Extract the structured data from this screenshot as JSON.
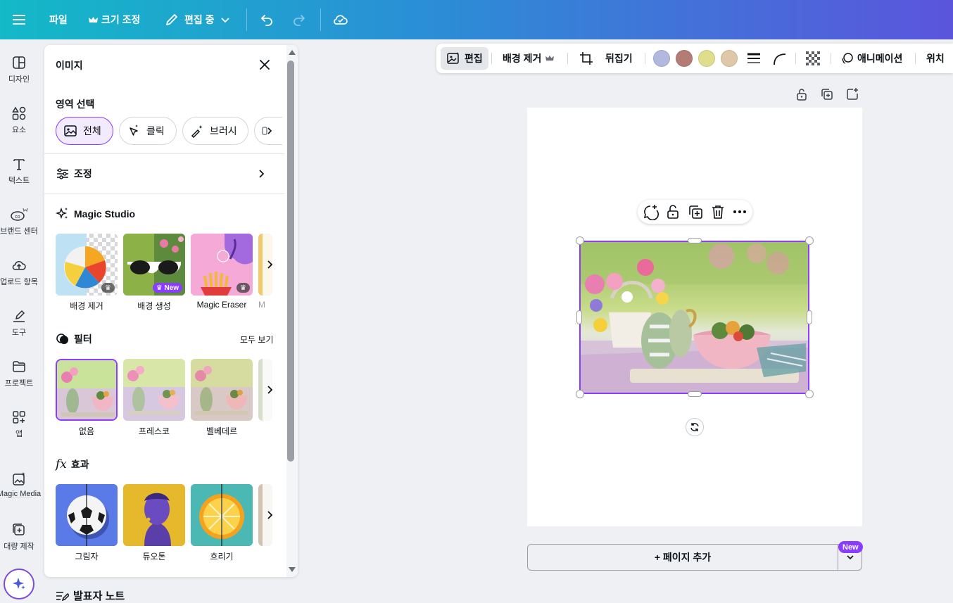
{
  "topbar": {
    "file": "파일",
    "resize": "크기 조정",
    "edit_mode": "편집 중"
  },
  "rail": {
    "items": [
      {
        "label": "디자인"
      },
      {
        "label": "요소"
      },
      {
        "label": "텍스트"
      },
      {
        "label": "브랜드 센터"
      },
      {
        "label": "업로드 항목"
      },
      {
        "label": "도구"
      },
      {
        "label": "프로젝트"
      },
      {
        "label": "앱"
      },
      {
        "label": "Magic Media"
      },
      {
        "label": "대량 제작"
      }
    ]
  },
  "panel": {
    "title": "이미지",
    "select_area": {
      "title": "영역 선택",
      "chips": [
        {
          "label": "전체"
        },
        {
          "label": "클릭"
        },
        {
          "label": "브러시"
        }
      ]
    },
    "adjust": "조정",
    "magic_studio": {
      "title": "Magic Studio",
      "items": [
        {
          "label": "배경 제거"
        },
        {
          "label": "배경 생성",
          "badge": "New"
        },
        {
          "label": "Magic Eraser"
        },
        {
          "label": "M"
        }
      ]
    },
    "filters": {
      "title": "필터",
      "see_all": "모두 보기",
      "items": [
        {
          "label": "없음"
        },
        {
          "label": "프레스코"
        },
        {
          "label": "벨베데르"
        }
      ]
    },
    "effects": {
      "title": "효과",
      "items": [
        {
          "label": "그림자"
        },
        {
          "label": "듀오톤"
        },
        {
          "label": "흐리기"
        }
      ]
    }
  },
  "context_toolbar": {
    "edit": "편집",
    "bg_remove": "배경 제거",
    "flip": "뒤집기",
    "swatches": [
      "#b3b8e0",
      "#b47c74",
      "#e0de8c",
      "#dec8a8"
    ],
    "animate": "애니메이션",
    "position": "위치"
  },
  "canvas": {
    "add_page": "+ 페이지 추가",
    "new_badge": "New"
  },
  "notes": "발표자 노트",
  "colors": {
    "accent": "#8b3dff"
  }
}
